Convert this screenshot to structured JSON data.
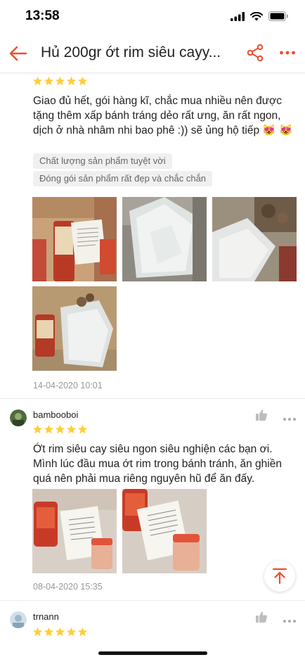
{
  "status": {
    "time": "13:58"
  },
  "header": {
    "title": "Hủ 200gr ớt rim siêu cayy...",
    "accent": "#ee4d2d"
  },
  "reviews": [
    {
      "username": "",
      "rating": 5,
      "text": "Giao đủ hết,  gói hàng kĩ, chắc mua nhiều nên được tặng thêm xấp bánh tráng dẻo rất ưng, ăn rất ngon, dịch ở nhà nhâm nhi bao phê :)) sẽ ủng hộ tiếp 😻 😻",
      "tags": [
        "Chất lượng sản phẩm tuyệt vời",
        "Đóng gói sản phẩm rất đẹp và chắc chắn"
      ],
      "timestamp": "14-04-2020 10:01"
    },
    {
      "username": "bambooboi",
      "rating": 5,
      "text": "Ớt rim siêu cay siêu ngon siêu nghiện các bạn ơi. Mình lúc đầu mua ớt rim trong bánh tránh, ăn ghiền quá nên phải mua riêng nguyên hũ để ăn đấy.",
      "timestamp": "08-04-2020 15:35"
    },
    {
      "username": "trnann",
      "rating": 5
    }
  ],
  "icons": {
    "back": "back-arrow-icon",
    "share": "share-icon",
    "more": "more-dots-icon",
    "like": "thumbs-up-icon",
    "scroll_top": "scroll-to-top-icon",
    "star": "star-icon"
  },
  "colors": {
    "accent": "#ee4d2d",
    "star": "#ffce3d",
    "muted": "#999999",
    "tag_bg": "#f0f0f0"
  }
}
